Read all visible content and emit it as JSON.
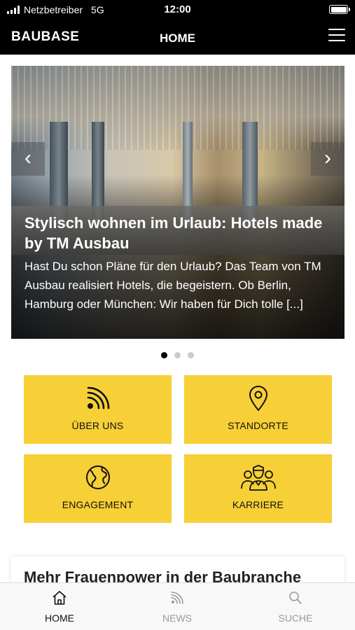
{
  "status_bar": {
    "carrier": "Netzbetreiber",
    "network": "5G",
    "time": "12:00"
  },
  "header": {
    "brand": "BAUBASE",
    "title": "HOME",
    "menu_icon": "hamburger-menu-icon"
  },
  "slider": {
    "title": "Stylisch wohnen im Urlaub: Hotels made by TM Ausbau",
    "excerpt": "Hast Du schon Pläne für den Urlaub? Das Team von TM Ausbau realisiert Hotels, die begeistern. Ob Berlin, Hamburg oder München: Wir haben für Dich tolle [...]",
    "prev_glyph": "‹",
    "next_glyph": "›",
    "total_slides": 3,
    "active_slide": 1
  },
  "tiles": [
    {
      "label": "ÜBER UNS",
      "icon": "rss-icon"
    },
    {
      "label": "STANDORTE",
      "icon": "location-pin-icon"
    },
    {
      "label": "ENGAGEMENT",
      "icon": "globe-icon"
    },
    {
      "label": "KARRIERE",
      "icon": "team-icon"
    }
  ],
  "news_card": {
    "title": "Mehr Frauenpower in der Baubranche"
  },
  "bottom_nav": [
    {
      "label": "HOME",
      "icon": "home-icon",
      "active": true
    },
    {
      "label": "NEWS",
      "icon": "rss-icon",
      "active": false
    },
    {
      "label": "SUCHE",
      "icon": "search-icon",
      "active": false
    }
  ],
  "colors": {
    "tile_yellow": "#f7cf36",
    "header_black": "#000000",
    "nav_inactive": "#999999"
  }
}
